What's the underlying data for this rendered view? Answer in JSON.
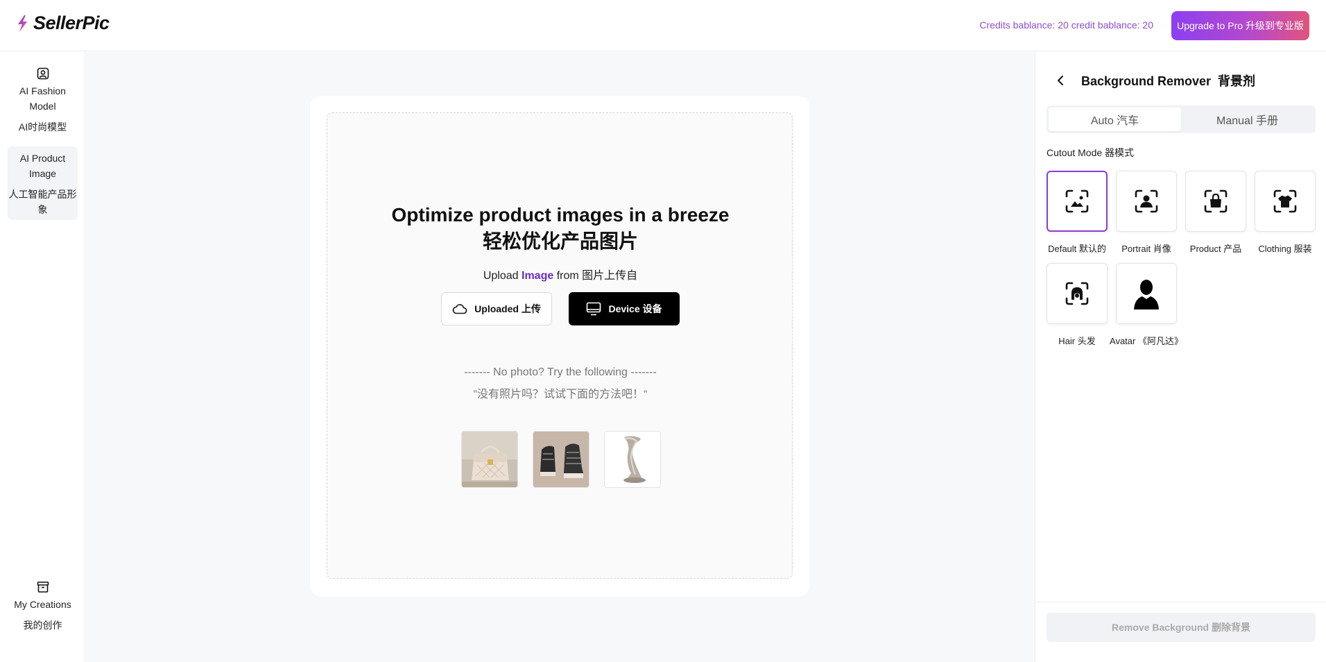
{
  "app": {
    "name": "SellerPic",
    "credits_text": "Credits bablance: 20 credit bablance: 20",
    "upgrade_label": "Upgrade to Pro 升级到专业版"
  },
  "sidebar": {
    "items": [
      {
        "label": "AI Fashion Model",
        "sub": "AI时尚模型",
        "icon": "user-portrait-icon"
      },
      {
        "label": "AI Product Image",
        "sub": "人工智能产品形象",
        "icon": null,
        "active": true
      },
      {
        "label": "My Creations",
        "sub": "我的创作",
        "icon": "archive-box-icon"
      }
    ]
  },
  "main": {
    "title_en": "Optimize product images in a breeze",
    "title_zh": "轻松优化产品图片",
    "upload_prefix": "Upload",
    "upload_highlight": "Image",
    "upload_suffix": "from 图片上传自",
    "upload_button": "Uploaded 上传",
    "device_button": "Device 设备",
    "nophoto_en": "------- No photo? Try the following -------",
    "nophoto_zh": "“没有照片吗？试试下面的方法吧！“",
    "samples": [
      "handbag-sample",
      "sneaker-sample",
      "faucet-sample"
    ]
  },
  "panel": {
    "title": "Background Remover  背景剂",
    "tabs": [
      {
        "label": "Auto 汽车",
        "active": true
      },
      {
        "label": "Manual 手册",
        "active": false
      }
    ],
    "cutout_label": "Cutout Mode 器模式",
    "modes": [
      {
        "label": "Default 默认的",
        "icon": "scan-image-icon",
        "selected": true
      },
      {
        "label": "Portrait 肖像",
        "icon": "scan-portrait-icon",
        "selected": false
      },
      {
        "label": "Product 产品",
        "icon": "scan-bag-icon",
        "selected": false
      },
      {
        "label": "Clothing 服装",
        "icon": "scan-shirt-icon",
        "selected": false
      },
      {
        "label": "Hair 头发",
        "icon": "scan-hair-icon",
        "selected": false
      },
      {
        "label": "Avatar 《阿凡达》",
        "icon": "avatar-silhouette-icon",
        "selected": false
      }
    ],
    "remove_button": "Remove Background 删除背景"
  },
  "colors": {
    "accent": "#8a3fd0",
    "upgrade_gradient_start": "#8b3ff2",
    "upgrade_gradient_end": "#e0557a",
    "highlight": "#6a2fc6"
  }
}
